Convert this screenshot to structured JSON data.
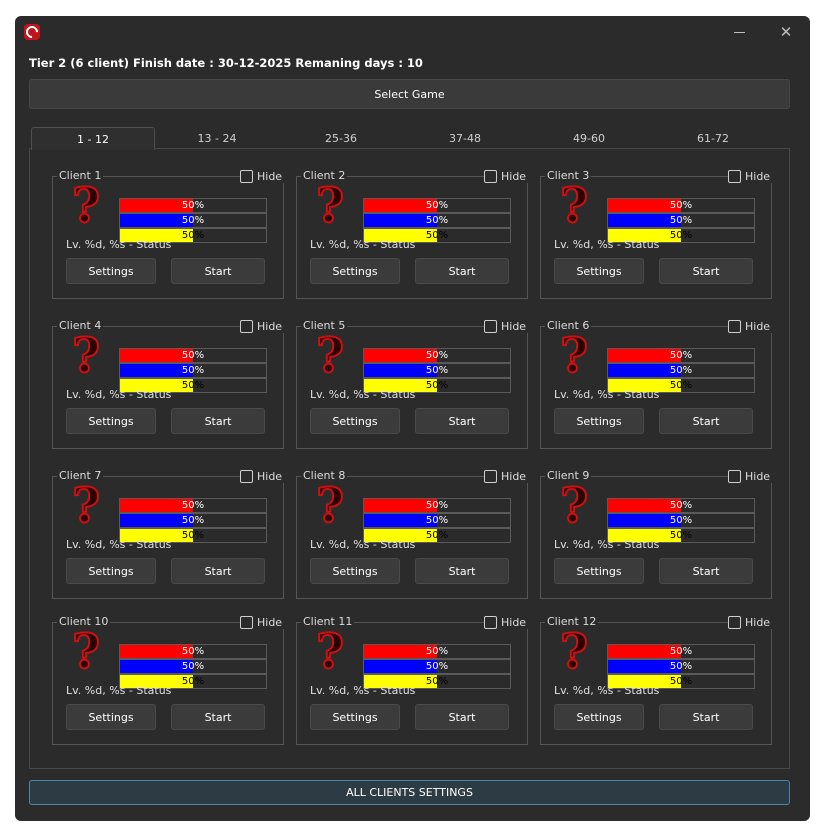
{
  "window": {
    "icon": "app-logo-icon",
    "minimize_icon": "minimize-icon",
    "close_icon": "close-icon",
    "close_glyph": "✕"
  },
  "status_line": "Tier 2 (6 client) Finish date : 30-12-2025 Remaning days : 10",
  "select_game_label": "Select Game",
  "tabs": [
    {
      "label": "1 - 12",
      "active": true
    },
    {
      "label": "13 - 24",
      "active": false
    },
    {
      "label": "25-36",
      "active": false
    },
    {
      "label": "37-48",
      "active": false
    },
    {
      "label": "49-60",
      "active": false
    },
    {
      "label": "61-72",
      "active": false
    }
  ],
  "bar_colors": {
    "red": "#ff0000",
    "blue": "#0000ff",
    "yellow": "#ffff00"
  },
  "clients": [
    {
      "title": "Client 1",
      "hide_label": "Hide",
      "icon": "question-mark-icon",
      "bars": [
        {
          "color": "red",
          "percent": 50,
          "text": "50%"
        },
        {
          "color": "blue",
          "percent": 50,
          "text": "50%"
        },
        {
          "color": "yellow",
          "percent": 50,
          "text": "50%"
        }
      ],
      "status": "Lv. %d, %s - Status",
      "settings_label": "Settings",
      "start_label": "Start"
    },
    {
      "title": "Client 2",
      "hide_label": "Hide",
      "icon": "question-mark-icon",
      "bars": [
        {
          "color": "red",
          "percent": 50,
          "text": "50%"
        },
        {
          "color": "blue",
          "percent": 50,
          "text": "50%"
        },
        {
          "color": "yellow",
          "percent": 50,
          "text": "50%"
        }
      ],
      "status": "Lv. %d, %s - Status",
      "settings_label": "Settings",
      "start_label": "Start"
    },
    {
      "title": "Client 3",
      "hide_label": "Hide",
      "icon": "question-mark-icon",
      "bars": [
        {
          "color": "red",
          "percent": 50,
          "text": "50%"
        },
        {
          "color": "blue",
          "percent": 50,
          "text": "50%"
        },
        {
          "color": "yellow",
          "percent": 50,
          "text": "50%"
        }
      ],
      "status": "Lv. %d, %s - Status",
      "settings_label": "Settings",
      "start_label": "Start"
    },
    {
      "title": "Client 4",
      "hide_label": "Hide",
      "icon": "question-mark-icon",
      "bars": [
        {
          "color": "red",
          "percent": 50,
          "text": "50%"
        },
        {
          "color": "blue",
          "percent": 50,
          "text": "50%"
        },
        {
          "color": "yellow",
          "percent": 50,
          "text": "50%"
        }
      ],
      "status": "Lv. %d, %s - Status",
      "settings_label": "Settings",
      "start_label": "Start"
    },
    {
      "title": "Client 5",
      "hide_label": "Hide",
      "icon": "question-mark-icon",
      "bars": [
        {
          "color": "red",
          "percent": 50,
          "text": "50%"
        },
        {
          "color": "blue",
          "percent": 50,
          "text": "50%"
        },
        {
          "color": "yellow",
          "percent": 50,
          "text": "50%"
        }
      ],
      "status": "Lv. %d, %s - Status",
      "settings_label": "Settings",
      "start_label": "Start"
    },
    {
      "title": "Client 6",
      "hide_label": "Hide",
      "icon": "question-mark-icon",
      "bars": [
        {
          "color": "red",
          "percent": 50,
          "text": "50%"
        },
        {
          "color": "blue",
          "percent": 50,
          "text": "50%"
        },
        {
          "color": "yellow",
          "percent": 50,
          "text": "50%"
        }
      ],
      "status": "Lv. %d, %s - Status",
      "settings_label": "Settings",
      "start_label": "Start"
    },
    {
      "title": "Client 7",
      "hide_label": "Hide",
      "icon": "question-mark-icon",
      "bars": [
        {
          "color": "red",
          "percent": 50,
          "text": "50%"
        },
        {
          "color": "blue",
          "percent": 50,
          "text": "50%"
        },
        {
          "color": "yellow",
          "percent": 50,
          "text": "50%"
        }
      ],
      "status": "Lv. %d, %s - Status",
      "settings_label": "Settings",
      "start_label": "Start"
    },
    {
      "title": "Client 8",
      "hide_label": "Hide",
      "icon": "question-mark-icon",
      "bars": [
        {
          "color": "red",
          "percent": 50,
          "text": "50%"
        },
        {
          "color": "blue",
          "percent": 50,
          "text": "50%"
        },
        {
          "color": "yellow",
          "percent": 50,
          "text": "50%"
        }
      ],
      "status": "Lv. %d, %s - Status",
      "settings_label": "Settings",
      "start_label": "Start"
    },
    {
      "title": "Client 9",
      "hide_label": "Hide",
      "icon": "question-mark-icon",
      "bars": [
        {
          "color": "red",
          "percent": 50,
          "text": "50%"
        },
        {
          "color": "blue",
          "percent": 50,
          "text": "50%"
        },
        {
          "color": "yellow",
          "percent": 50,
          "text": "50%"
        }
      ],
      "status": "Lv. %d, %s - Status",
      "settings_label": "Settings",
      "start_label": "Start"
    },
    {
      "title": "Client 10",
      "hide_label": "Hide",
      "icon": "question-mark-icon",
      "bars": [
        {
          "color": "red",
          "percent": 50,
          "text": "50%"
        },
        {
          "color": "blue",
          "percent": 50,
          "text": "50%"
        },
        {
          "color": "yellow",
          "percent": 50,
          "text": "50%"
        }
      ],
      "status": "Lv. %d, %s - Status",
      "settings_label": "Settings",
      "start_label": "Start"
    },
    {
      "title": "Client 11",
      "hide_label": "Hide",
      "icon": "question-mark-icon",
      "bars": [
        {
          "color": "red",
          "percent": 50,
          "text": "50%"
        },
        {
          "color": "blue",
          "percent": 50,
          "text": "50%"
        },
        {
          "color": "yellow",
          "percent": 50,
          "text": "50%"
        }
      ],
      "status": "Lv. %d, %s - Status",
      "settings_label": "Settings",
      "start_label": "Start"
    },
    {
      "title": "Client 12",
      "hide_label": "Hide",
      "icon": "question-mark-icon",
      "bars": [
        {
          "color": "red",
          "percent": 50,
          "text": "50%"
        },
        {
          "color": "blue",
          "percent": 50,
          "text": "50%"
        },
        {
          "color": "yellow",
          "percent": 50,
          "text": "50%"
        }
      ],
      "status": "Lv. %d, %s - Status",
      "settings_label": "Settings",
      "start_label": "Start"
    }
  ],
  "all_clients_settings_label": "ALL CLIENTS SETTINGS",
  "accent_color": "#4c87a8"
}
